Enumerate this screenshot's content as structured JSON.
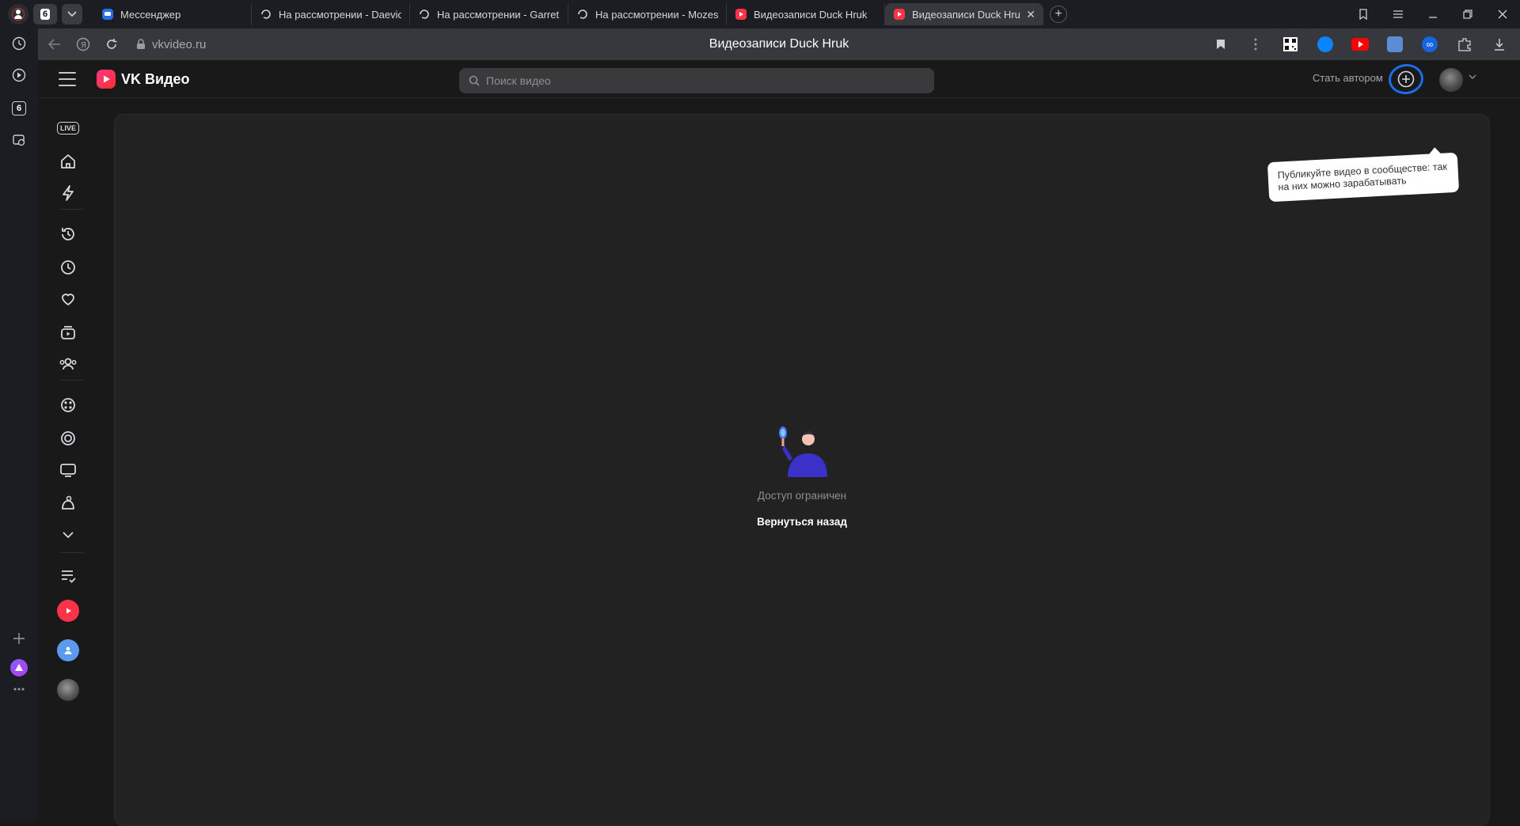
{
  "browser": {
    "tab_count": "6",
    "tabs": [
      {
        "label": "Мессенджер",
        "icon": "messenger-icon",
        "active": false
      },
      {
        "label": "На рассмотрении - Daevic",
        "icon": "review-site-icon",
        "active": false
      },
      {
        "label": "На рассмотрении - Garret",
        "icon": "review-site-icon",
        "active": false
      },
      {
        "label": "На рассмотрении - Mozes",
        "icon": "review-site-icon",
        "active": false
      },
      {
        "label": "Видеозаписи Duck Hruk",
        "icon": "vk-video-icon",
        "active": false
      },
      {
        "label": "Видеозаписи Duck Hruk",
        "icon": "vk-video-icon",
        "active": true
      }
    ],
    "address": "vkvideo.ru",
    "page_title": "Видеозаписи Duck Hruk",
    "yandex_tab_badge": "6"
  },
  "vk": {
    "logo_text": "VK Видео",
    "search_placeholder": "Поиск видео",
    "become_author": "Стать автором",
    "tooltip": "Публикуйте видео в сообществе: так на них можно зарабатывать",
    "empty_text": "Доступ ограничен",
    "back_link": "Вернуться назад",
    "live_label": "LIVE",
    "accent_color": "#1a6fe8",
    "brand_color": "#ff3347"
  }
}
